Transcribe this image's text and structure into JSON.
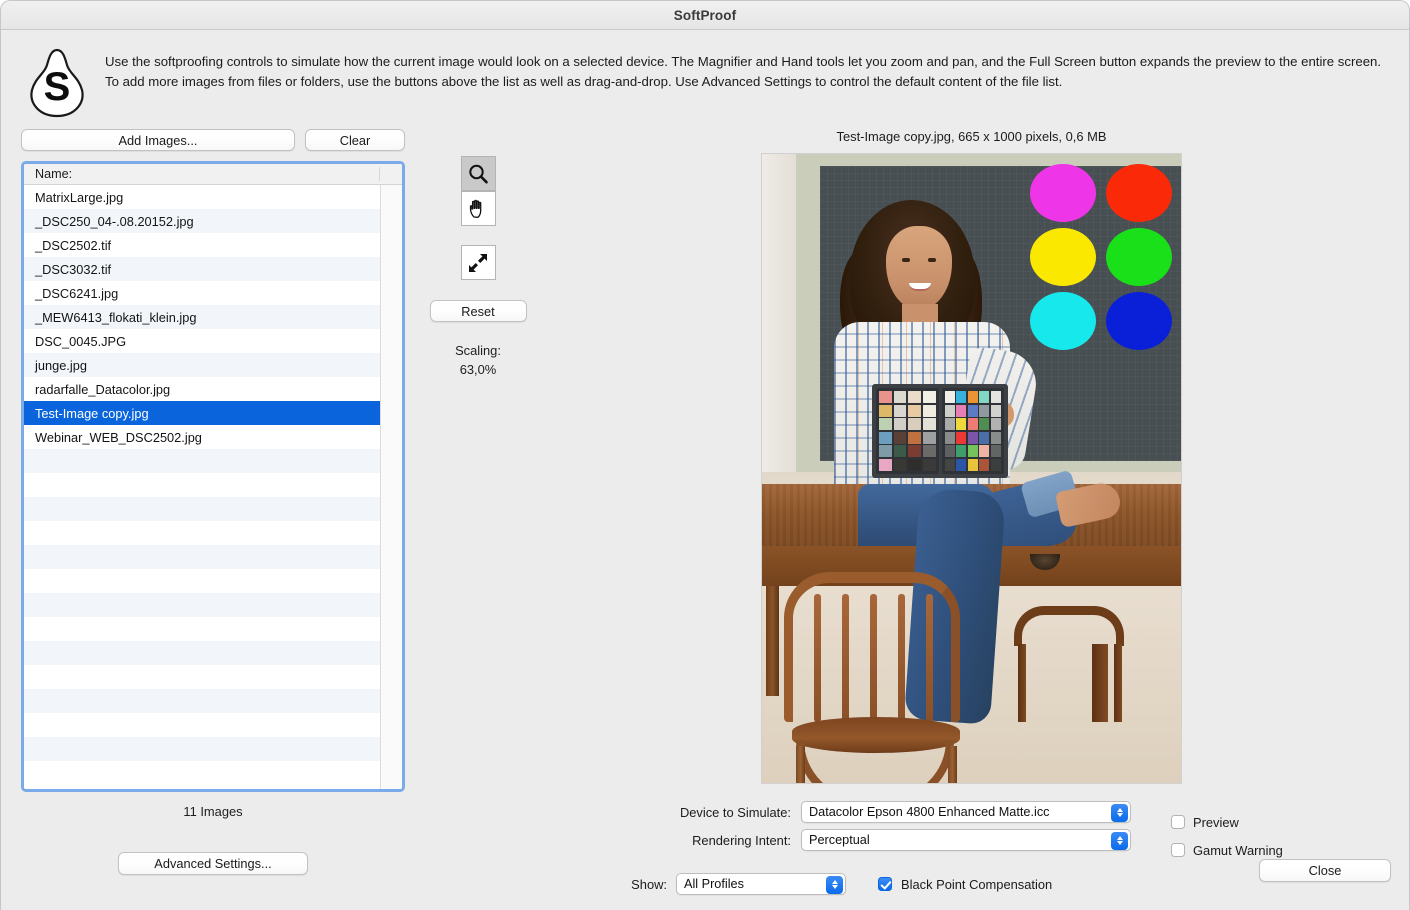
{
  "window": {
    "title": "SoftProof"
  },
  "header": {
    "logo_letter": "S",
    "intro": "Use the softproofing controls to simulate how the current image would look on a selected device. The Magnifier and Hand tools let you zoom and pan, and the Full Screen button expands the preview to the entire screen. To add more images from files or folders, use the buttons above the list as well as drag-and-drop. Use Advanced Settings to control the default content of the file list."
  },
  "file_panel": {
    "add_images_label": "Add Images...",
    "clear_label": "Clear",
    "column_header": "Name:",
    "files": [
      "MatrixLarge.jpg",
      "_DSC250_04-.08.20152.jpg",
      "_DSC2502.tif",
      "_DSC3032.tif",
      "_DSC6241.jpg",
      "_MEW6413_flokati_klein.jpg",
      "DSC_0045.JPG",
      "junge.jpg",
      "radarfalle_Datacolor.jpg",
      "Test-Image copy.jpg",
      "Webinar_WEB_DSC2502.jpg"
    ],
    "selected_file": "Test-Image copy.jpg",
    "selected_index": 9,
    "count_label": "11 Images",
    "advanced_settings_label": "Advanced Settings...",
    "selection_color": "#0a64dc",
    "focus_ring_color": "#7aabe8"
  },
  "tools": {
    "magnifier_icon": "magnifier-icon",
    "hand_icon": "hand-icon",
    "fullscreen_icon": "fullscreen-icon",
    "active_tool": "magnifier",
    "reset_label": "Reset",
    "scaling_label": "Scaling:",
    "scaling_value": "63,0%"
  },
  "preview": {
    "caption": "Test-Image copy.jpg, 665 x 1000 pixels, 0,6 MB",
    "circle_colors": [
      "#ef35e8",
      "#fa2a09",
      "#fbe800",
      "#1ae01a",
      "#16e8ec",
      "#0a20d8"
    ],
    "checker_left": [
      "#e8938c",
      "#dcd9d0",
      "#eadcc8",
      "#f2efe6",
      "#ddb869",
      "#d8d6cf",
      "#e9c9a2",
      "#f0ece1",
      "#bdd0b2",
      "#d0cec6",
      "#d9cdbb",
      "#e4e1d6",
      "#6d9dbf",
      "#5b4038",
      "#c1703f",
      "#9fa0a2",
      "#7f9ba8",
      "#3c5a48",
      "#7a3c33",
      "#6b6a68",
      "#e8a8c4",
      "#3a3835",
      "#2f2e2c",
      "#3b3a38"
    ],
    "checker_right": [
      "#f1efe9",
      "#36b3dc",
      "#eb9433",
      "#7fd7c4",
      "#e4e3dd",
      "#cfd0cb",
      "#e87fb4",
      "#5b7cc5",
      "#9098a0",
      "#d2d3ce",
      "#a9abab",
      "#edd93c",
      "#ef7c74",
      "#4f8d50",
      "#b2b3b0",
      "#8a8c8c",
      "#ea3a33",
      "#7a55a8",
      "#4a6ea8",
      "#8b8d8d",
      "#5e6061",
      "#3f9e6c",
      "#74c45b",
      "#efb3a6",
      "#636464",
      "#434544",
      "#2b56a8",
      "#e8c43a",
      "#a8553a",
      "#3d3f3e"
    ]
  },
  "bottom": {
    "device_label": "Device to Simulate:",
    "device_value": "Datacolor Epson 4800 Enhanced Matte.icc",
    "intent_label": "Rendering Intent:",
    "intent_value": "Perceptual",
    "show_label": "Show:",
    "show_value": "All Profiles",
    "preview_checkbox_label": "Preview",
    "preview_checked": false,
    "gamut_checkbox_label": "Gamut Warning",
    "gamut_checked": false,
    "bpc_checkbox_label": "Black Point Compensation",
    "bpc_checked": true,
    "close_label": "Close",
    "accent_color": "#0a6bea"
  }
}
